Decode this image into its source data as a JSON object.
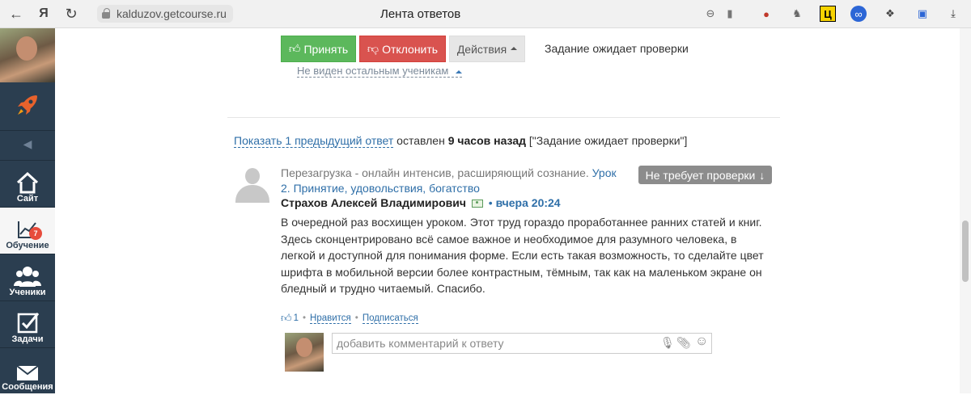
{
  "browser": {
    "url": "kalduzov.getcourse.ru",
    "tab_title": "Лента ответов"
  },
  "sidebar": {
    "items": [
      {
        "label": "Сайт"
      },
      {
        "label": "Обучение",
        "badge": "7"
      },
      {
        "label": "Ученики"
      },
      {
        "label": "Задачи"
      },
      {
        "label": "Сообщения"
      }
    ]
  },
  "actions": {
    "accept_label": "Принять",
    "reject_label": "Отклонить",
    "actions_label": "Действия",
    "status": "Задание ожидает проверки",
    "visibility": "Не виден остальным ученикам"
  },
  "previous": {
    "link": "Показать 1 предыдущий ответ",
    "left_text": "оставлен",
    "age": "9 часов назад",
    "status_bracket": "[\"Задание ожидает проверки\"]"
  },
  "answer": {
    "course": "Перезагрузка - онлайн интенсив, расширяющий сознание.",
    "lesson_link": "Урок 2. Принятие, удовольствия, богатство",
    "no_check_label": "Не требует проверки",
    "author": "Страхов Алексей Владимирович",
    "bullet": "•",
    "time": "вчера 20:24",
    "text": "В очередной раз восхищен уроком. Этот труд гораздо проработаннее ранних статей и книг. Здесь сконцентрировано всё самое важное и необходимое для разумного человека, в легкой и доступной для понимания форме. Если есть такая возможность, то сделайте цвет шрифта в мобильной версии более контрастным, тёмным, так как на маленьком экране он бледный и трудно читаемый. Спасибо.",
    "likes": "1",
    "like_label": "Нравится",
    "subscribe_label": "Подписаться",
    "comment_placeholder": "добавить комментарий к ответу"
  }
}
